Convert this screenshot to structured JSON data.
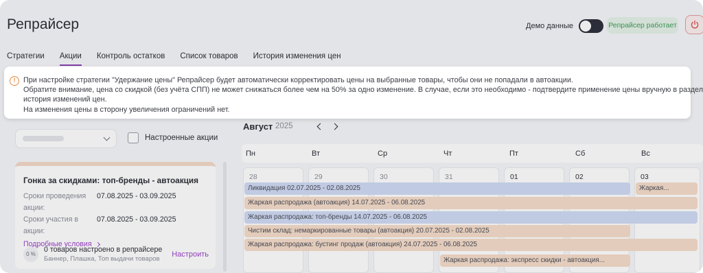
{
  "app": {
    "title": "Репрайсер",
    "demo_label": "Демо данные",
    "status": "Репрайсер работает"
  },
  "tabs": [
    {
      "label": "Стратегии",
      "active": false
    },
    {
      "label": "Акции",
      "active": true
    },
    {
      "label": "Контроль остатков",
      "active": false
    },
    {
      "label": "Список товаров",
      "active": false
    },
    {
      "label": "История изменения цен",
      "active": false
    }
  ],
  "notice": {
    "lines": [
      "При настройке стратегии \"Удержание цены\" Репрайсер будет автоматически корректировать цены на выбранные товары, чтобы они не попадали в автоакции.",
      "Обратите внимание, цена со скидкой (без учёта СПП) не может снижаться более чем на 50% за одно изменение. В случае, если это необходимо - подтвердите применение цены вручную в разделе",
      "история изменений цен.",
      "На изменения цены в сторону увеличения ограничений нет."
    ]
  },
  "filter": {
    "checkbox_label": "Настроенные акции"
  },
  "promo": {
    "title": "Гонка за скидками: топ-бренды - автоакция",
    "rows": [
      {
        "key": "Сроки проведения акции:",
        "value": "07.08.2025 - 03.09.2025"
      },
      {
        "key": "Сроки участия в акции:",
        "value": "07.08.2025 - 03.09.2025"
      }
    ],
    "details_link": "Подробные условия",
    "percent": "0 %",
    "configured_text": "0 товаров настроено в репрайсере",
    "configured_sub": "Баннер, Плашка, Топ выдачи товаров",
    "configure_link": "Настроить"
  },
  "calendar": {
    "month": "Август",
    "year": "2025",
    "weekdays": [
      "Пн",
      "Вт",
      "Ср",
      "Чт",
      "Пт",
      "Сб",
      "Вс"
    ],
    "dates": [
      {
        "num": "28",
        "current": false
      },
      {
        "num": "29",
        "current": false
      },
      {
        "num": "30",
        "current": false
      },
      {
        "num": "31",
        "current": false
      },
      {
        "num": "01",
        "current": true
      },
      {
        "num": "02",
        "current": true
      },
      {
        "num": "03",
        "current": true
      }
    ],
    "events": [
      {
        "label": "Ликвидация 02.07.2025 - 02.08.2025",
        "color": "blue",
        "start": 0,
        "span": 6
      },
      {
        "label": "Жаркая...",
        "color": "orange",
        "start": 6,
        "span": 1
      },
      {
        "label": "Жаркая распродажа (автоакция) 14.07.2025 - 06.08.2025",
        "color": "orange",
        "start": 0,
        "span": 7
      },
      {
        "label": "Жаркая распродажа: топ-бренды 14.07.2025 - 06.08.2025",
        "color": "blue",
        "start": 0,
        "span": 7
      },
      {
        "label": "Чистим склад: немаркированные товары (автоакция) 20.07.2025 - 02.08.2025",
        "color": "orange",
        "start": 0,
        "span": 6
      },
      {
        "label": "Жаркая распродажа: бустинг продаж (автоакция) 24.07.2025 - 06.08.2025",
        "color": "orange",
        "start": 0,
        "span": 7
      },
      {
        "label": "Жаркая распродажа: экспресс скидки - автоакция...",
        "color": "orange",
        "start": 3,
        "span": 3
      }
    ]
  }
}
